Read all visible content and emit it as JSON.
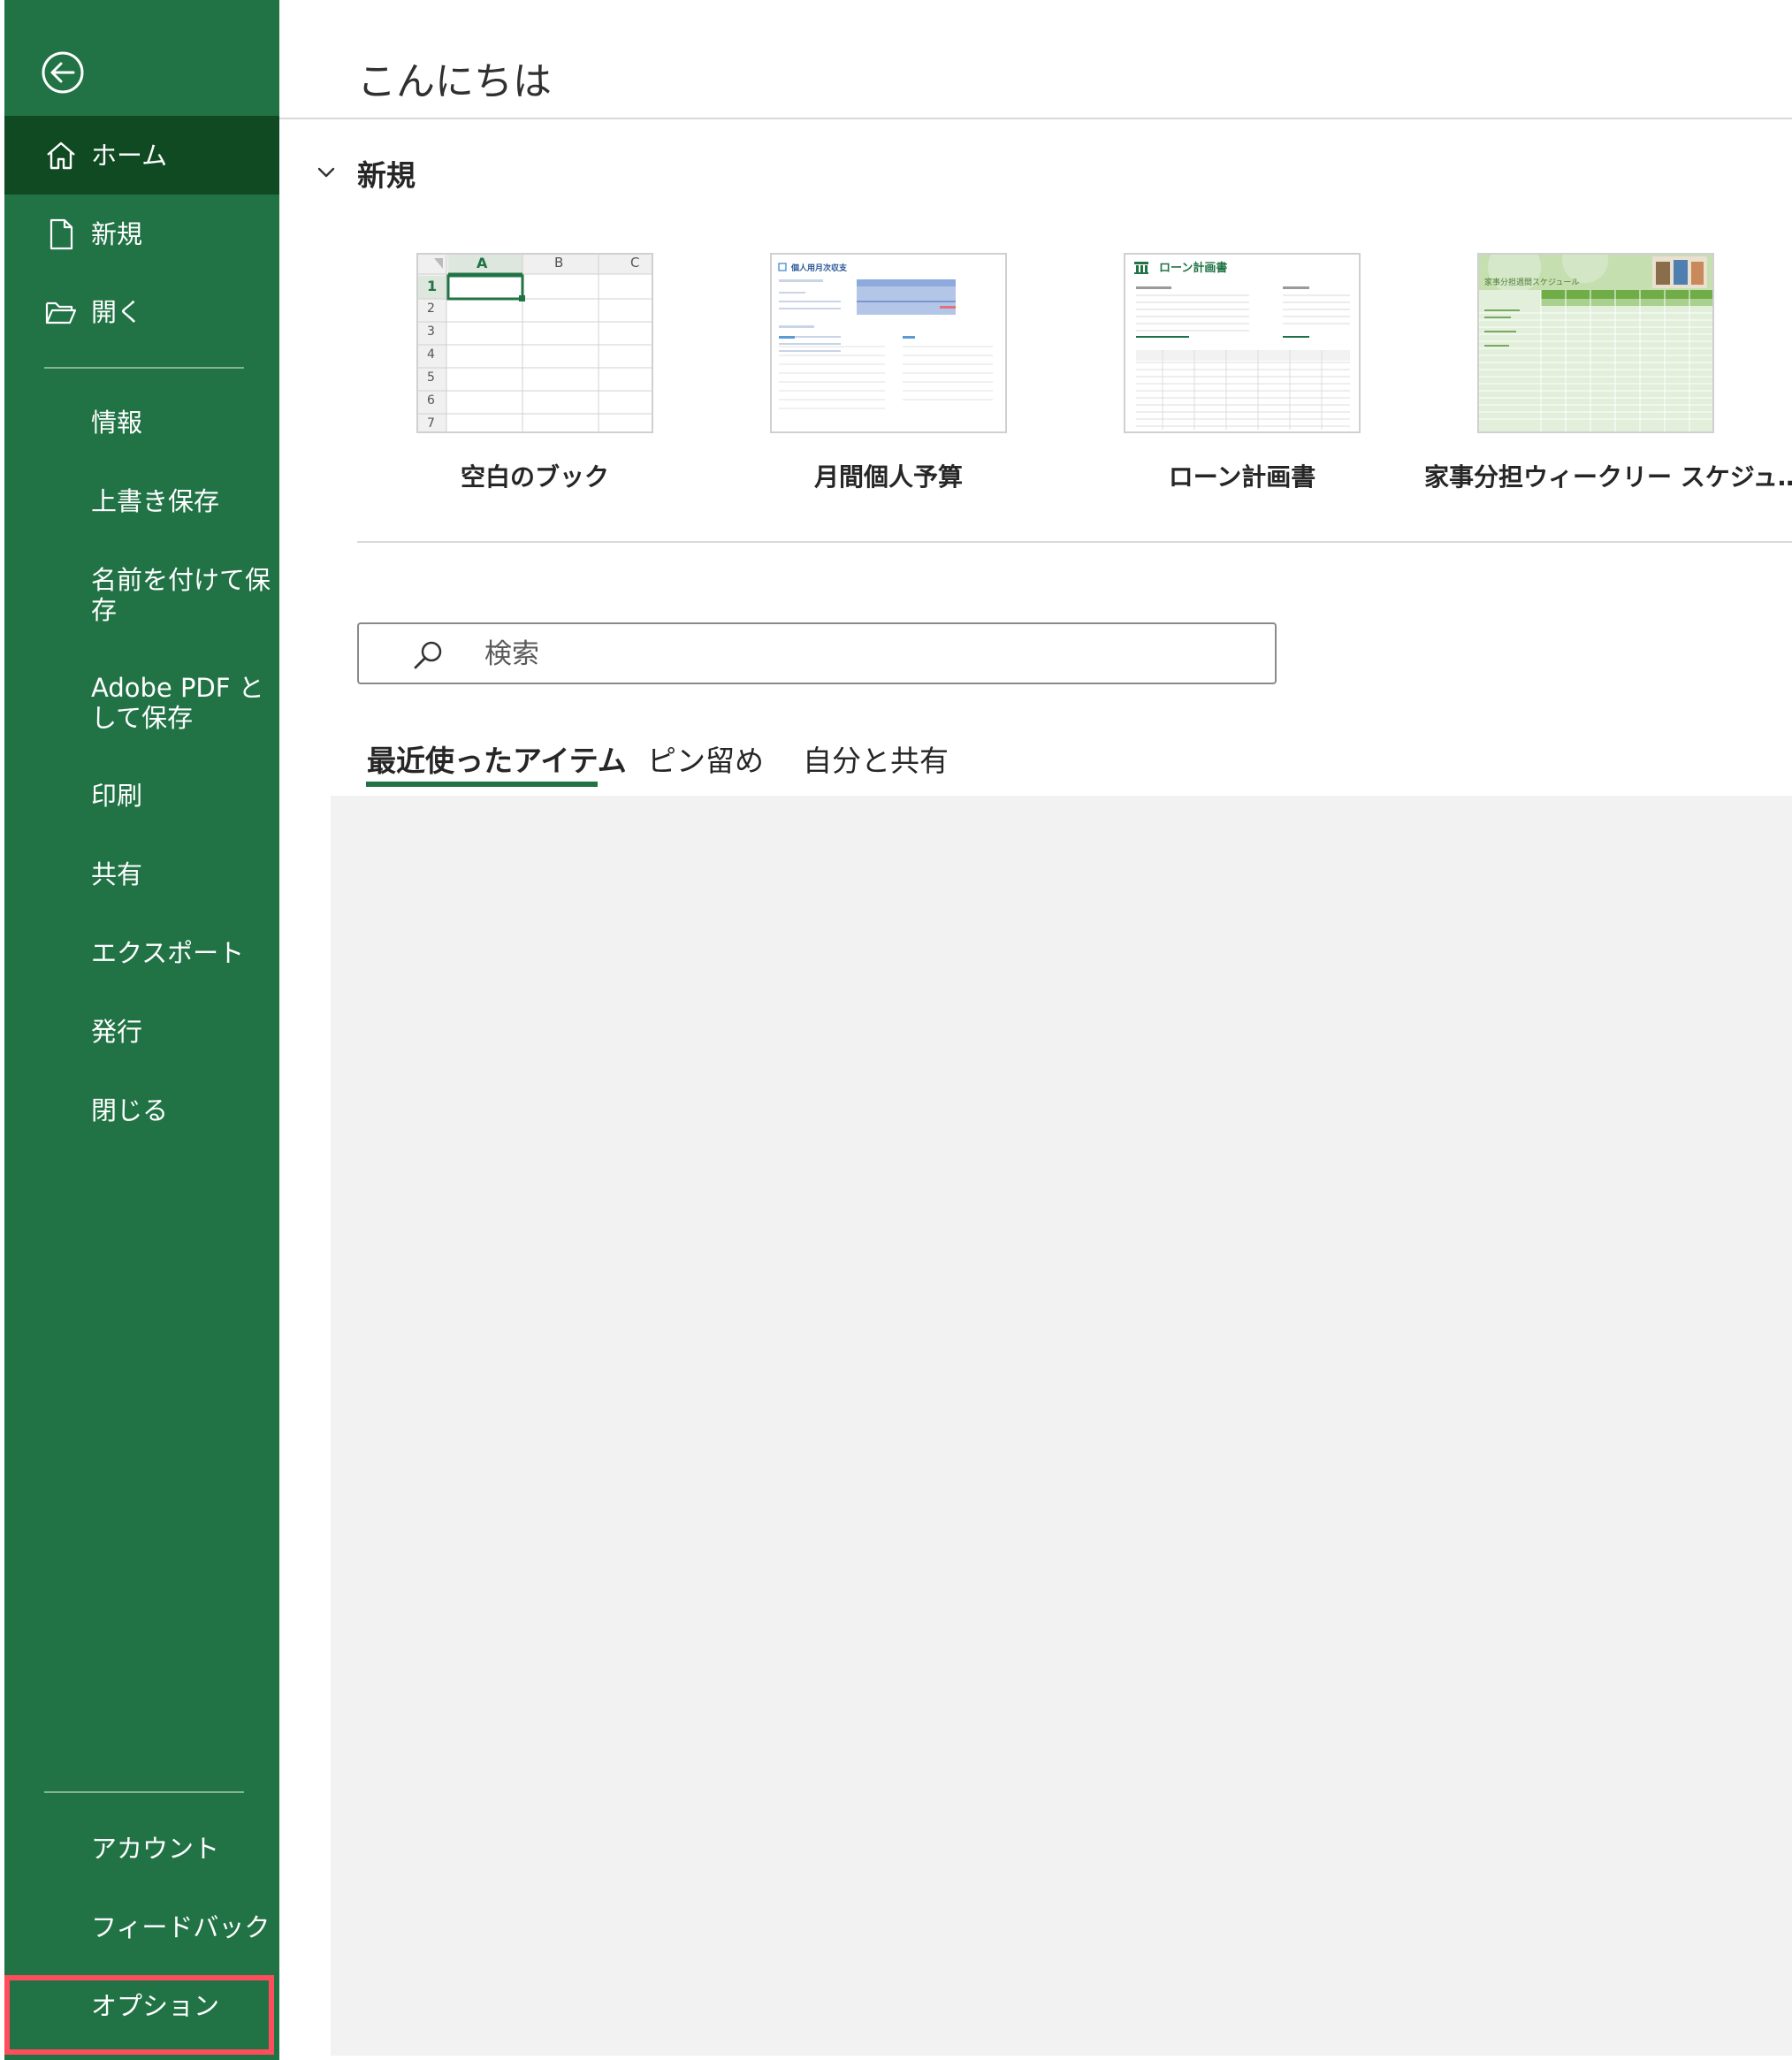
{
  "colors": {
    "sidebar": "#217346",
    "sidebar_active": "#0f4a23",
    "highlight": "#ff4d5c",
    "panel": "#f2f2f2"
  },
  "sidebar": {
    "back_icon": "back-arrow-icon",
    "home": "ホーム",
    "new": "新規",
    "open": "開く",
    "info": "情報",
    "save": "上書き保存",
    "save_as": "名前を付けて保存",
    "save_pdf": "Adobe PDF として保存",
    "print": "印刷",
    "share": "共有",
    "export": "エクスポート",
    "publish": "発行",
    "close": "閉じる",
    "account": "アカウント",
    "feedback": "フィードバック",
    "options": "オプション"
  },
  "main": {
    "greeting": "こんにちは",
    "new_section": "新規",
    "templates": [
      {
        "caption": "空白のブック"
      },
      {
        "caption": "月間個人予算",
        "thumb_title": "個人用月次収支"
      },
      {
        "caption": "ローン計画書",
        "thumb_title": "ローン計画書"
      },
      {
        "caption": "家事分担ウィークリー スケジュ…",
        "thumb_title": "家事分担週間スケジュール"
      }
    ],
    "blank_grid": {
      "cols": [
        "A",
        "B",
        "C"
      ],
      "rows": [
        "1",
        "2",
        "3",
        "4",
        "5",
        "6",
        "7"
      ]
    },
    "search_placeholder": "検索",
    "tabs": [
      "最近使ったアイテム",
      "ピン留め",
      "自分と共有"
    ]
  }
}
